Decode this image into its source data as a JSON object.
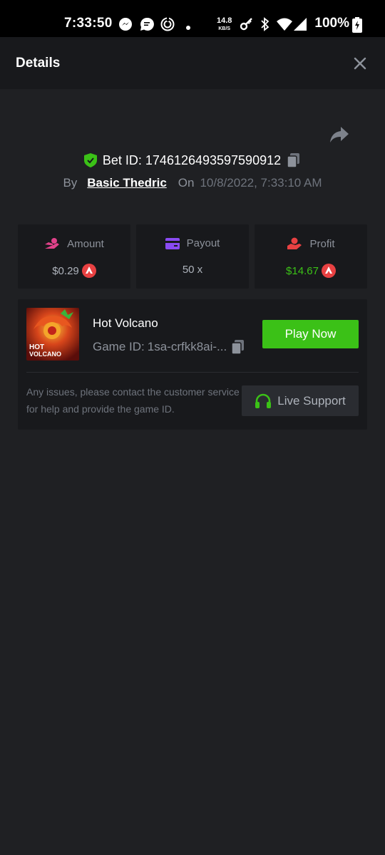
{
  "status_bar": {
    "time": "7:33:50",
    "net_speed_value": "14.8",
    "net_speed_unit": "KB/S",
    "battery": "100%",
    "icons": [
      "messenger-icon",
      "chat-icon",
      "sync-icon",
      "dot-icon",
      "vpn-key-icon",
      "bluetooth-icon",
      "wifi-icon",
      "signal-icon",
      "battery-charging-icon"
    ]
  },
  "header": {
    "title": "Details",
    "close_icon": "close-icon"
  },
  "bet": {
    "id_label": "Bet ID:",
    "id_value": "1746126493597590912",
    "by_label": "By",
    "user": "Basic Thedric",
    "on_label": "On",
    "date": "10/8/2022, 7:33:10 AM"
  },
  "stats": [
    {
      "label": "Amount",
      "value": "$0.29",
      "icon": "money-hand-icon",
      "currency_icon": "avax-icon"
    },
    {
      "label": "Payout",
      "value": "50 x",
      "icon": "card-icon"
    },
    {
      "label": "Profit",
      "value": "$14.67",
      "icon": "profit-hand-icon",
      "currency_icon": "avax-icon"
    }
  ],
  "game": {
    "name": "Hot Volcano",
    "id_label": "Game ID:",
    "id_value": "1sa-crfkk8ai-...",
    "thumb_line1": "HOT",
    "thumb_line2": "VOLCANO",
    "play_label": "Play Now"
  },
  "support": {
    "text": "Any issues, please contact the customer service for help and provide the game ID.",
    "button_label": "Live Support"
  },
  "colors": {
    "background": "#1f2023",
    "panel": "#18191c",
    "accent_green": "#3bc117",
    "avax_red": "#e84142"
  }
}
